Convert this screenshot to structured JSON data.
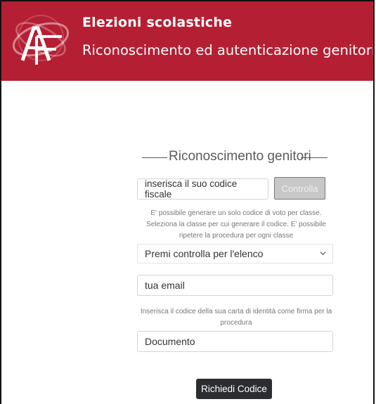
{
  "header": {
    "title": "Elezioni scolastiche",
    "subtitle": "Riconoscimento ed autenticazione genitori",
    "logo_icon": "af-logo-icon",
    "background_color": "#b51f33"
  },
  "form": {
    "section_title": "Riconoscimento genitori",
    "codice_fiscale_value": "inserisca il suo codice fiscale",
    "controlla_label": "Controlla",
    "help_text_1": "E' possibile generare un solo codice di voto per classe. Seleziona la classe per cui generare il codice. E' possibile ripetere la procedura per ogni classe",
    "select_value": "Premi controlla per l'elenco",
    "select_icon": "chevron-down-icon",
    "email_value": "tua email",
    "help_text_2": "Inserisca il codice della sua carta di identità come firma per la procedura",
    "documento_value": "Documento",
    "submit_label": "Richiedi Codice",
    "submit_color": "#2b2d31"
  }
}
